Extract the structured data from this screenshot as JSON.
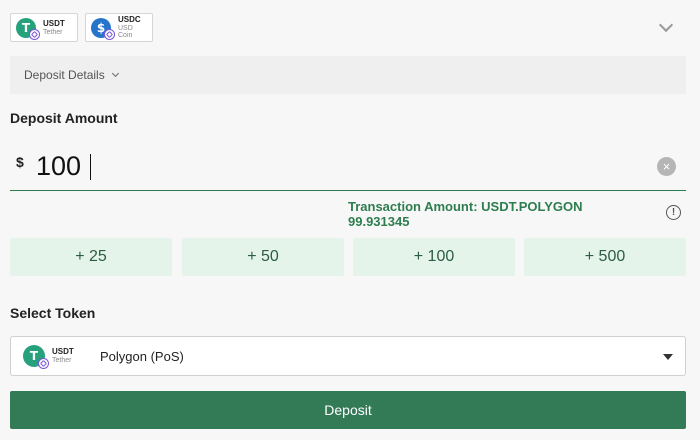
{
  "tokens": [
    {
      "symbol": "USDT",
      "name": "Tether",
      "logo_letter": "T",
      "color": "#26a17b",
      "icon": "tether-icon"
    },
    {
      "symbol": "USDC",
      "name": "USD Coin",
      "logo_letter": "$",
      "color": "#2775ca",
      "icon": "usd-coin-icon"
    }
  ],
  "deposit_details": {
    "label": "Deposit Details"
  },
  "deposit_amount": {
    "title": "Deposit Amount",
    "currency_symbol": "$",
    "value": "100",
    "clear_icon": "×"
  },
  "transaction": {
    "line1": "Transaction Amount: USDT.POLYGON",
    "line2": "99.931345",
    "info_icon": "!"
  },
  "quick_amounts": [
    "+ 25",
    "+ 50",
    "+ 100",
    "+ 500"
  ],
  "select_token": {
    "title": "Select Token",
    "selected_symbol": "USDT",
    "selected_name": "Tether",
    "network": "Polygon (PoS)"
  },
  "deposit_button": {
    "label": "Deposit"
  },
  "colors": {
    "accent": "#337a56",
    "quick_bg": "#e5f4ea",
    "tether": "#26a17b",
    "usdc": "#2775ca",
    "polygon": "#7b56d8"
  }
}
